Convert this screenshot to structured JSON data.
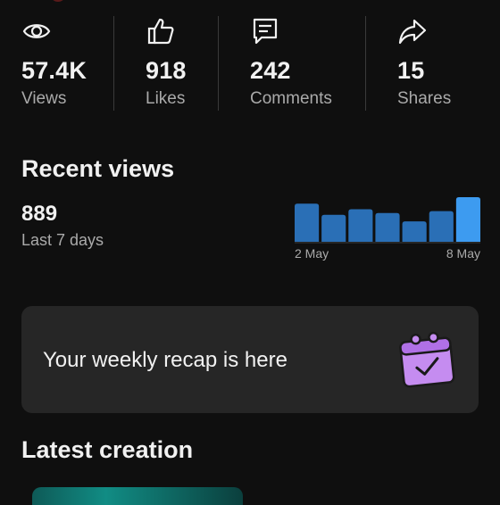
{
  "stats": [
    {
      "icon": "eye-icon",
      "value": "57.4K",
      "label": "Views"
    },
    {
      "icon": "thumbs-up-icon",
      "value": "918",
      "label": "Likes"
    },
    {
      "icon": "comment-icon",
      "value": "242",
      "label": "Comments"
    },
    {
      "icon": "share-icon",
      "value": "15",
      "label": "Shares"
    }
  ],
  "recent_views": {
    "title": "Recent views",
    "value": "889",
    "subtitle": "Last 7 days",
    "chart_data": {
      "type": "bar",
      "values": [
        41,
        29,
        35,
        31,
        22,
        33,
        48
      ],
      "x_start_label": "2 May",
      "x_end_label": "8 May",
      "bar_color": "#2a6fb6",
      "highlight_color": "#3d9bf0"
    }
  },
  "recap": {
    "text": "Your weekly recap is here",
    "icon": "calendar-check-icon",
    "icon_color": "#c58cf0"
  },
  "latest": {
    "title": "Latest creation"
  }
}
